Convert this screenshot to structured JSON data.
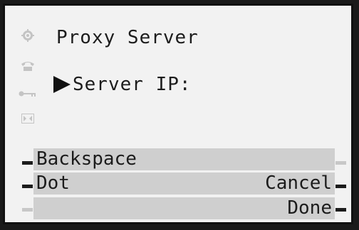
{
  "screen": {
    "title": "Proxy Server",
    "field_label": "Server IP:",
    "field_value": ""
  },
  "side_icons": [
    "settings-gear-icon",
    "phone-handset-icon",
    "key-icon",
    "bookmark-icon"
  ],
  "softkeys": {
    "backspace": "Backspace",
    "dot": "Dot",
    "cancel": "Cancel",
    "done": "Done"
  },
  "colors": {
    "display_bg": "#f2f2f2",
    "softkey_bar": "#cfcfcf",
    "text": "#1c1c1c",
    "bezel": "#1a1a1a"
  }
}
